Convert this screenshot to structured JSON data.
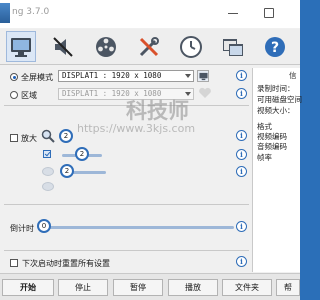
{
  "window": {
    "title": "ng 3.7.0"
  },
  "toolbar": {
    "tools": [
      {
        "icon": "monitor-icon",
        "active": true
      },
      {
        "icon": "mute-speaker-icon"
      },
      {
        "icon": "film-reel-icon"
      },
      {
        "icon": "tools-icon"
      },
      {
        "icon": "clock-icon"
      },
      {
        "icon": "windows-icon"
      },
      {
        "icon": "help-icon"
      }
    ]
  },
  "capture": {
    "fullscreen_label": "全屏模式",
    "fullscreen_value": "DISPLAT1 : 1920 x 1080",
    "region_label": "区域",
    "region_value": "DISPLAT1 : 1920 x 1080"
  },
  "zoom": {
    "label": "放大",
    "value1": "2",
    "value2": "2",
    "value3": "2"
  },
  "countdown": {
    "label": "倒计时",
    "value": "0"
  },
  "reset": {
    "label": "下次启动时重置所有设置"
  },
  "info_panel": {
    "heading": "信",
    "record_time": "录制时间：",
    "disk_space": "可用磁盘空间",
    "video_size": "视频大小：",
    "format": "格式",
    "video_codec": "视频编码",
    "audio_codec": "音频编码",
    "fps": "帧率"
  },
  "watermark": {
    "brand": "科技师",
    "url": "https://www.3kjs.com"
  },
  "buttons": {
    "start": "开始",
    "stop": "停止",
    "pause": "暂停",
    "play": "播放",
    "folder": "文件夹",
    "help": "帮"
  },
  "colors": {
    "accent": "#2f6db8",
    "window_bg": "#f0f0f0"
  }
}
